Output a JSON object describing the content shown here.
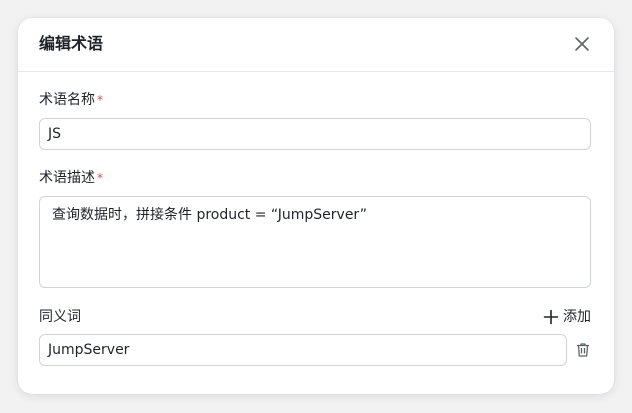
{
  "dialog": {
    "title": "编辑术语",
    "close_icon": "close-icon"
  },
  "fields": {
    "name": {
      "label": "术语名称",
      "required_mark": "*",
      "value": "JS"
    },
    "description": {
      "label": "术语描述",
      "required_mark": "*",
      "value": "查询数据时，拼接条件 product = “JumpServer”"
    },
    "synonyms": {
      "label": "同义词",
      "add_label": "添加",
      "add_icon": "plus-icon",
      "items": [
        {
          "value": "JumpServer",
          "delete_icon": "trash-icon"
        }
      ]
    }
  },
  "colors": {
    "required": "#e5484d",
    "border": "#d0d3d9",
    "text": "#1f2329"
  }
}
